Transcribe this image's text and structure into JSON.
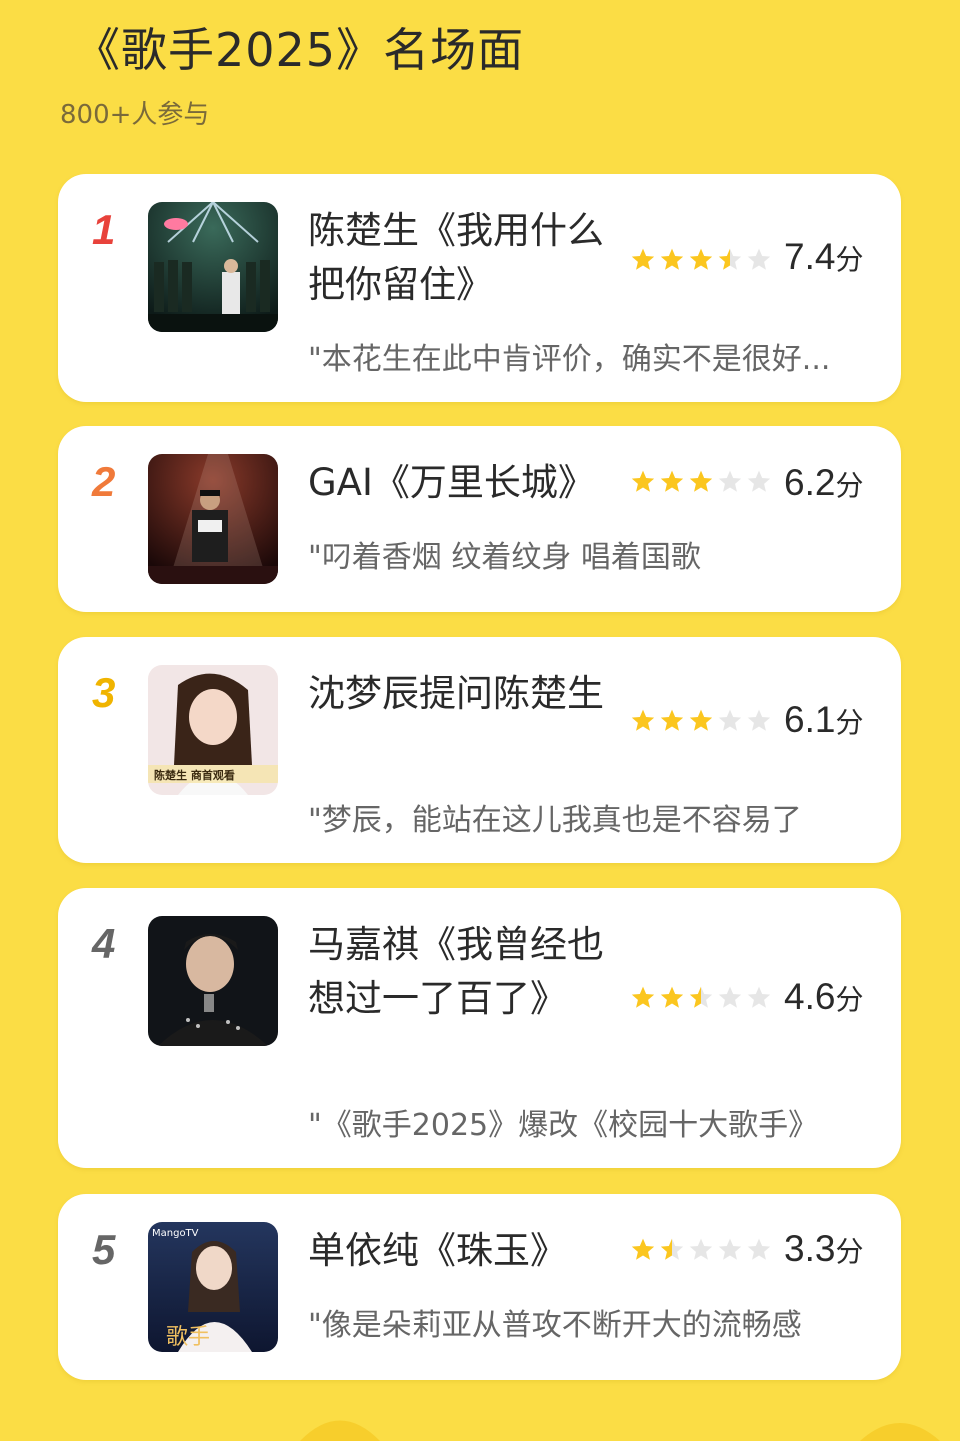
{
  "header": {
    "title": "《歌手2025》名场面",
    "participants": "800+人参与"
  },
  "score_unit": "分",
  "rank_colors": {
    "1": "#e8423b",
    "2": "#f07a3a",
    "3": "#f0b400",
    "4": "#666666",
    "5": "#666666"
  },
  "star_color_on": "#fbc61f",
  "star_color_off": "#e6e6e6",
  "items": [
    {
      "rank": "1",
      "title": "陈楚生《我用什么把你留住》",
      "rating": 3.5,
      "score": "7.4",
      "quote": "\"本花生在此中肯评价，确实不是很好..."
    },
    {
      "rank": "2",
      "title": "GAI《万里长城》",
      "rating": 3,
      "score": "6.2",
      "quote": "\"叼着香烟 纹着纹身 唱着国歌"
    },
    {
      "rank": "3",
      "title": "沈梦辰提问陈楚生",
      "rating": 3,
      "score": "6.1",
      "quote": "\"梦辰，能站在这儿我真也是不容易了"
    },
    {
      "rank": "4",
      "title": "马嘉祺《我曾经也想过一了百了》",
      "rating": 2.5,
      "score": "4.6",
      "quote": "\"《歌手2025》爆改《校园十大歌手》"
    },
    {
      "rank": "5",
      "title": "单依纯《珠玉》",
      "rating": 1.5,
      "score": "3.3",
      "quote": "\"像是朵莉亚从普攻不断开大的流畅感"
    }
  ],
  "thumb_captions": {
    "3": "陈楚生 商首观看",
    "5_logo": "MangoTV",
    "5_watermark": "歌手"
  }
}
